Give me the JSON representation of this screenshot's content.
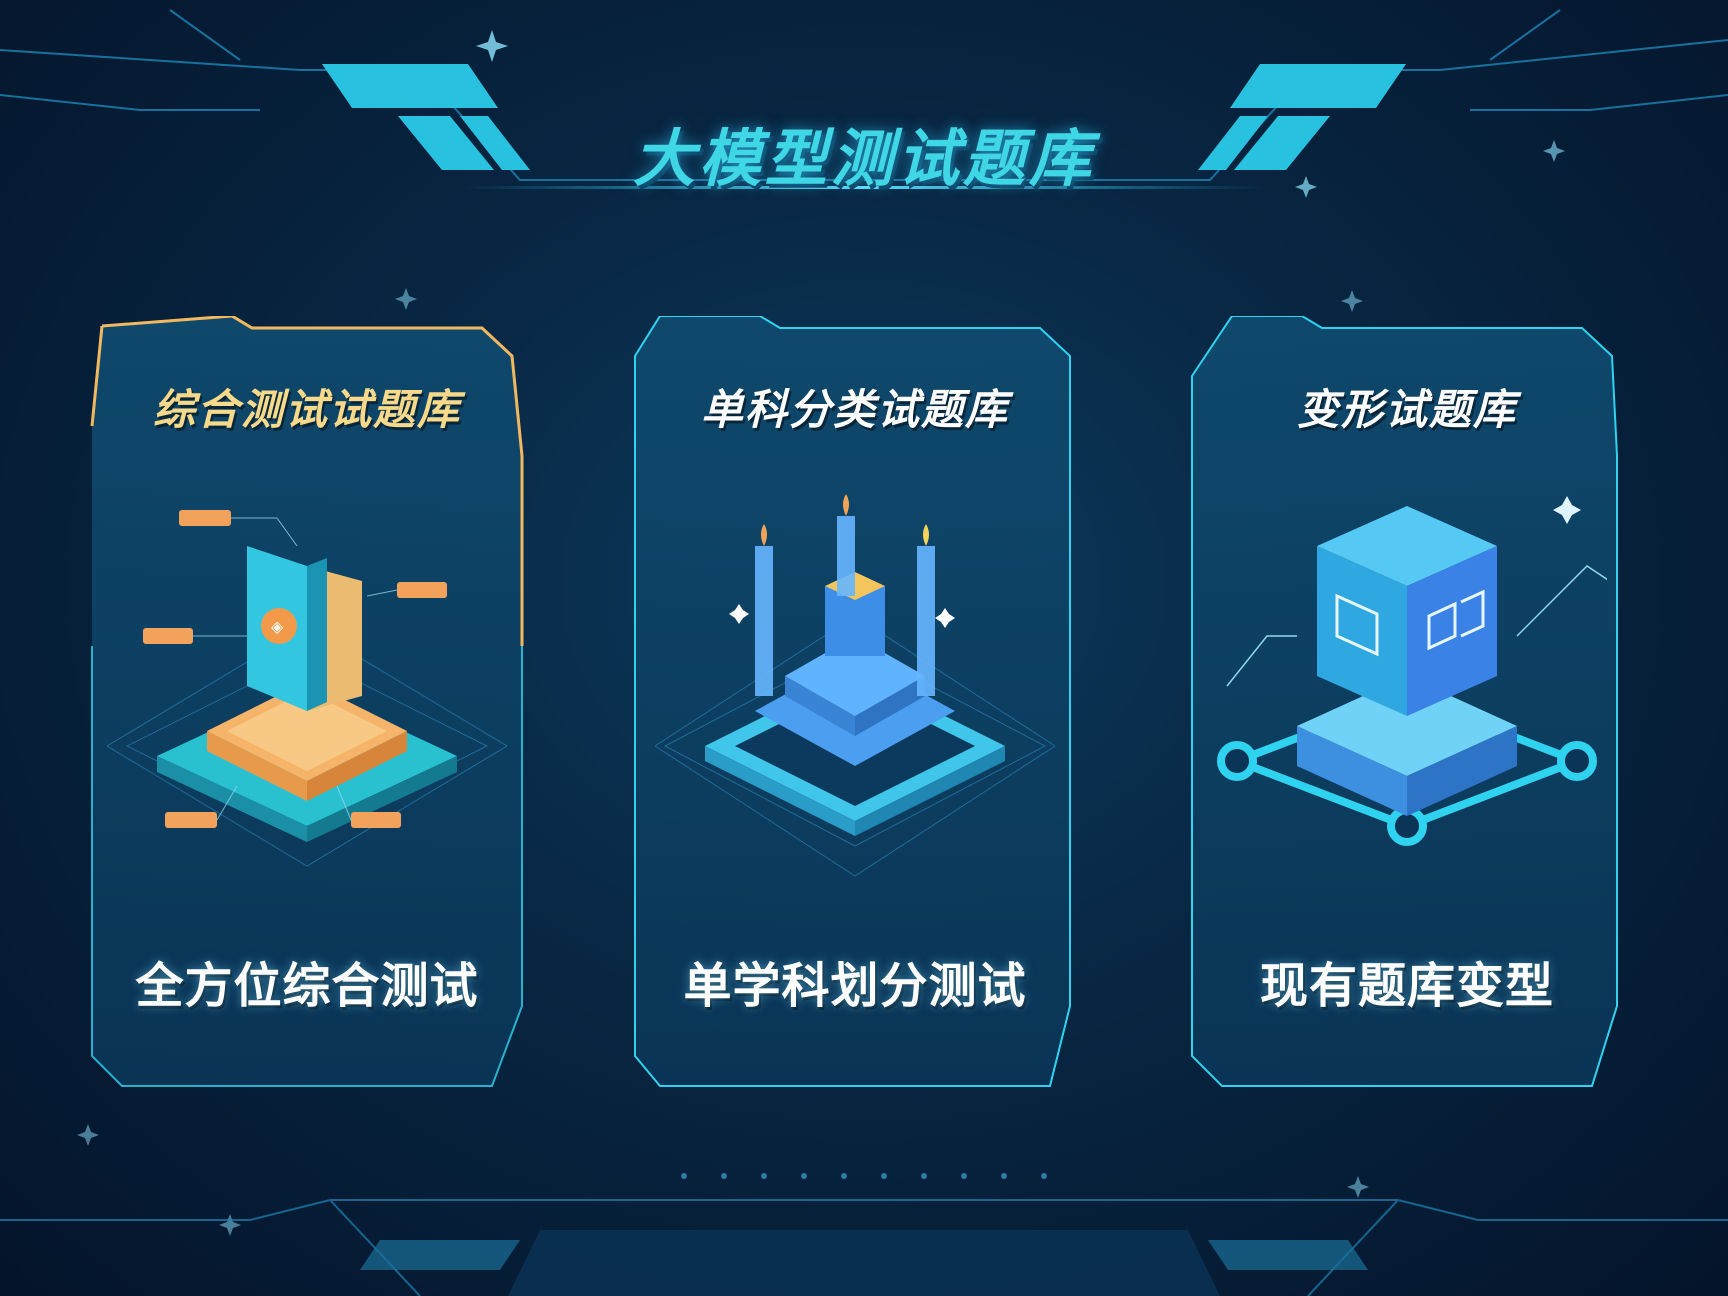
{
  "page": {
    "title": "大模型测试题库"
  },
  "cards": [
    {
      "title": "综合测试试题库",
      "subtitle": "全方位综合测试",
      "accent": "#f2b860"
    },
    {
      "title": "单科分类试题库",
      "subtitle": "单学科划分测试",
      "accent": "#36c7e6"
    },
    {
      "title": "变形试题库",
      "subtitle": "现有题库变型",
      "accent": "#36c7e6"
    }
  ],
  "colors": {
    "background": "#082642",
    "title": "#3fd6e6",
    "panel": "#0e4467",
    "cyan": "#2fd3ef",
    "gold": "#f2b860"
  },
  "icons": [
    "folder-document-icon",
    "stacked-server-icon",
    "cube-module-icon"
  ]
}
